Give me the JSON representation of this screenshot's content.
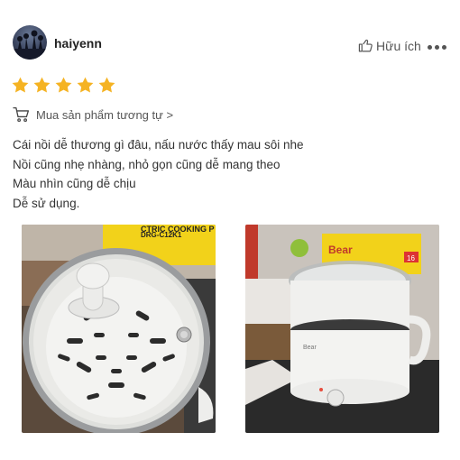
{
  "user": {
    "name": "haiyenn"
  },
  "actions": {
    "helpful_label": "Hữu ích"
  },
  "rating": {
    "stars": 5,
    "max": 5,
    "color": "#f5b323"
  },
  "similar_link": {
    "label": "Mua sản phẩm tương tự >"
  },
  "review": {
    "lines": [
      "Cái nồi dễ thương gì đâu, nấu nước thấy mau sôi nhe",
      "Nồi cũng nhẹ nhàng, nhỏ gọn cũng dễ mang theo",
      "Màu nhìn cũng dễ chịu",
      "Dễ sử dụng."
    ]
  },
  "photos": {
    "photo1": {
      "box_text_1": "DRG-C12K1",
      "box_text_2": "CTRIC COOKING P"
    },
    "photo2": {
      "box_text_1": "Bear",
      "box_text_2": "16",
      "product_logo": "Bear"
    }
  }
}
